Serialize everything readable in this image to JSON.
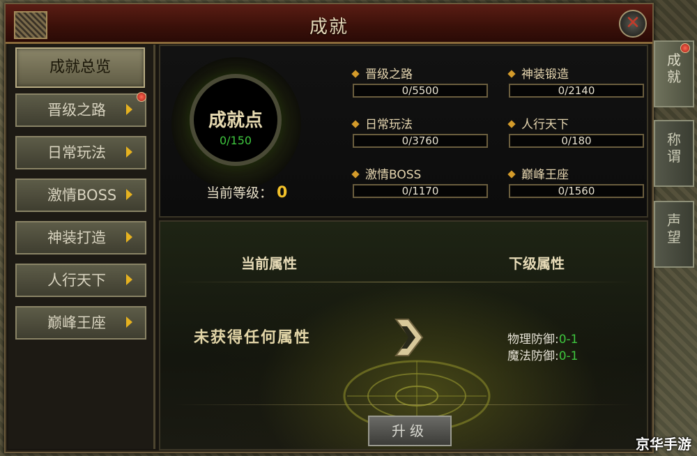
{
  "window": {
    "title": "成就"
  },
  "menu": {
    "overview": "成就总览",
    "items": [
      {
        "label": "晋级之路",
        "badge": true
      },
      {
        "label": "日常玩法",
        "badge": false
      },
      {
        "label": "激情BOSS",
        "badge": false
      },
      {
        "label": "神装打造",
        "badge": false
      },
      {
        "label": "人行天下",
        "badge": false
      },
      {
        "label": "巅峰王座",
        "badge": false
      }
    ]
  },
  "points": {
    "label": "成就点",
    "value": "0/150",
    "level_label": "当前等级：",
    "level": "0"
  },
  "progress": [
    {
      "label": "晋级之路",
      "value": "0/5500"
    },
    {
      "label": "神装锻造",
      "value": "0/2140"
    },
    {
      "label": "日常玩法",
      "value": "0/3760"
    },
    {
      "label": "人行天下",
      "value": "0/180"
    },
    {
      "label": "激情BOSS",
      "value": "0/1170"
    },
    {
      "label": "巅峰王座",
      "value": "0/1560"
    }
  ],
  "attributes": {
    "current_header": "当前属性",
    "next_header": "下级属性",
    "current_text": "未获得任何属性",
    "next": [
      {
        "name": "物理防御:",
        "value": "0-1"
      },
      {
        "name": "魔法防御:",
        "value": "0-1"
      }
    ],
    "upgrade_label": "升级"
  },
  "side_tabs": [
    {
      "label": "成就",
      "active": true,
      "badge": true
    },
    {
      "label": "称谓",
      "active": false,
      "badge": false
    },
    {
      "label": "声望",
      "active": false,
      "badge": false
    }
  ],
  "watermark": "京华手游",
  "colors": {
    "green_value": "#3ec63e",
    "gold_accent": "#f2c12a",
    "title_bar": "#3a1009"
  }
}
